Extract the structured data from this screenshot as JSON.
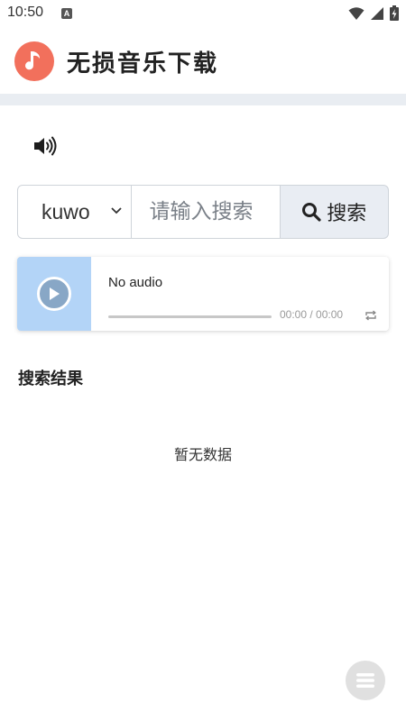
{
  "status_bar": {
    "time": "10:50",
    "notification_badge": "A",
    "icons": [
      "wifi-icon",
      "signal-icon",
      "battery-charging-icon"
    ]
  },
  "header": {
    "title": "无损音乐下载",
    "logo_icon": "music-note-icon",
    "logo_color": "#f2705c"
  },
  "volume": {
    "icon": "speaker-icon"
  },
  "search": {
    "source_selected": "kuwo",
    "placeholder": "请输入搜索",
    "value": "",
    "button_label": "搜索",
    "button_icon": "magnifier-icon"
  },
  "player": {
    "title": "No audio",
    "time": "00:00 / 00:00",
    "progress": 0,
    "cover_color": "#b3d4f7"
  },
  "results": {
    "heading": "搜索结果",
    "empty_text": "暂无数据"
  },
  "fab": {
    "icon": "menu-icon"
  }
}
